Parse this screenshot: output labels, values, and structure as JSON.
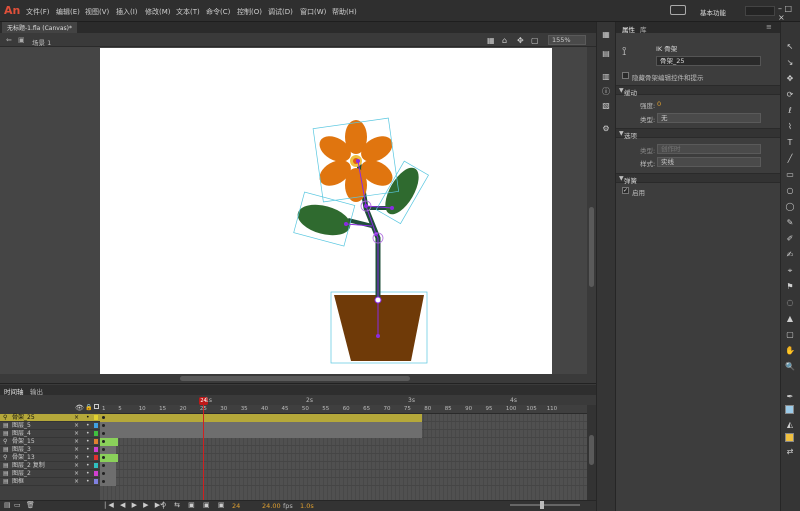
{
  "app": {
    "logo": "An",
    "workspace": "基本功能"
  },
  "menu": [
    "文件(F)",
    "编辑(E)",
    "视图(V)",
    "插入(I)",
    "修改(M)",
    "文本(T)",
    "命令(C)",
    "控制(O)",
    "调试(D)",
    "窗口(W)",
    "帮助(H)"
  ],
  "document": {
    "tab": "无标题-1.fla (Canvas)*",
    "scene": "场景 1",
    "zoom": "155%"
  },
  "panel": {
    "tabs": [
      "属性",
      "库"
    ],
    "type_label": "IK 骨架",
    "instance_name": "骨架_25",
    "hide_hints": "隐藏骨架编辑控件和提示",
    "ease_section": "缓动",
    "strength_label": "强度:",
    "strength_value": "0",
    "type_label2": "类型:",
    "type_value": "无",
    "options_section": "选项",
    "options_type_label": "类型:",
    "options_type_value": "创作时",
    "style_label": "样式:",
    "style_value": "实线",
    "spring_section": "弹簧",
    "enable_label": "启用"
  },
  "timeline": {
    "tabs": [
      "时间轴",
      "输出"
    ],
    "layers": [
      {
        "name": "骨架_25",
        "selected": true
      },
      {
        "name": "图层_5"
      },
      {
        "name": "图层_4"
      },
      {
        "name": "骨架_15"
      },
      {
        "name": "图层_3"
      },
      {
        "name": "骨架_13"
      },
      {
        "name": "图层_2 复制"
      },
      {
        "name": "图层_2"
      },
      {
        "name": "图框"
      }
    ],
    "ruler": [
      "1",
      "5",
      "10",
      "15",
      "20",
      "25",
      "30",
      "35",
      "40",
      "45",
      "50",
      "55",
      "60",
      "65",
      "70",
      "75",
      "80",
      "85",
      "90",
      "95",
      "100",
      "105",
      "110"
    ],
    "seconds": [
      "1s",
      "2s",
      "3s",
      "4s"
    ],
    "current_frame": "24",
    "fps": "24.00",
    "fps_unit": "fps",
    "elapsed": "1.0s"
  },
  "colors": {
    "accent": "#b5a83a",
    "petal": "#e0750f",
    "leaf": "#2f6a2f",
    "stem": "#1f4f3a",
    "pot": "#6f3a08",
    "bone": "#8a2be2"
  }
}
